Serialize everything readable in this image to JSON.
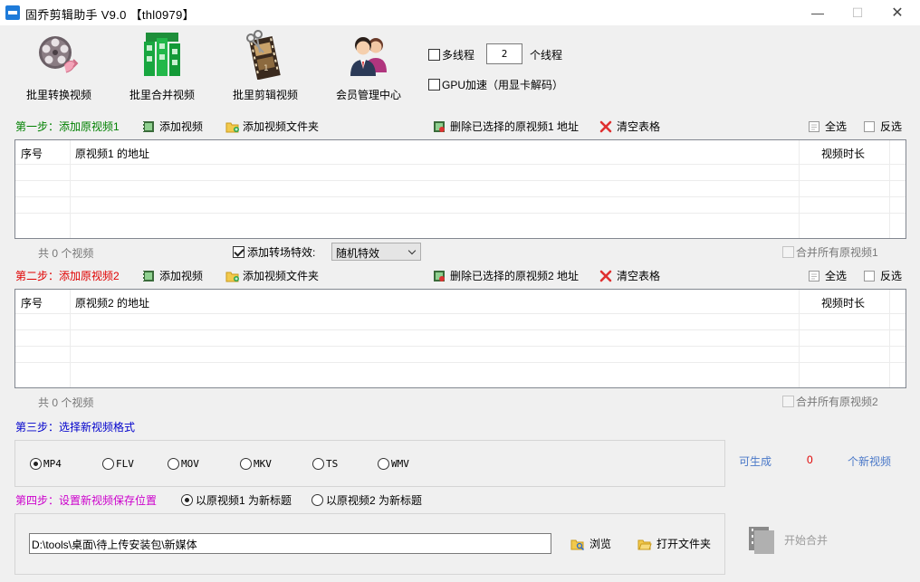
{
  "window": {
    "title": "固乔剪辑助手 V9.0  【thl0979】",
    "minimize": "—",
    "maximize": "☐",
    "close": "✕"
  },
  "toolbar": {
    "batch_convert": "批里转换视频",
    "batch_merge": "批里合并视频",
    "batch_cut": "批里剪辑视频",
    "member_center": "会员管理中心"
  },
  "options": {
    "multithread_label": "多线程",
    "multithread_checked": false,
    "thread_count": "2",
    "thread_unit": "个线程",
    "gpu_label": "GPU加速（用显卡解码）",
    "gpu_checked": false
  },
  "step1": {
    "label": "第一步：添加原视频1",
    "add_video": "添加视频",
    "add_folder": "添加视频文件夹",
    "delete_selected": "删除已选择的原视频1 地址",
    "clear_table": "清空表格",
    "select_all": "全选",
    "invert": "反选",
    "col_index": "序号",
    "col_path": "原视频1 的地址",
    "col_duration": "视频时长",
    "count_text": "共 0 个视频",
    "merge_all": "合并所有原视频1",
    "color": "#008000"
  },
  "transition": {
    "label": "添加转场特效:",
    "checked": true,
    "selected": "随机特效"
  },
  "step2": {
    "label": "第二步：添加原视频2",
    "add_video": "添加视频",
    "add_folder": "添加视频文件夹",
    "delete_selected": "删除已选择的原视频2 地址",
    "clear_table": "清空表格",
    "select_all": "全选",
    "invert": "反选",
    "col_index": "序号",
    "col_path": "原视频2 的地址",
    "col_duration": "视频时长",
    "count_text": "共 0 个视频",
    "merge_all": "合并所有原视频2",
    "color": "#e00000"
  },
  "step3": {
    "label": "第三步：选择新视频格式",
    "color": "#0000cc",
    "formats": [
      "MP4",
      "FLV",
      "MOV",
      "MKV",
      "TS",
      "WMV"
    ],
    "selected_format": "MP4",
    "can_generate": "可生成",
    "generate_count": "0",
    "new_videos": "个新视频"
  },
  "step4": {
    "label": "第四步：设置新视频保存位置",
    "color": "#cc00cc",
    "title_option1": "以原视频1 为新标题",
    "title_option2": "以原视频2 为新标题",
    "selected_title_option": 1,
    "save_path": "D:\\tools\\桌面\\待上传安装包\\新媒体",
    "browse": "浏览",
    "open_folder": "打开文件夹",
    "start_merge": "开始合并"
  }
}
